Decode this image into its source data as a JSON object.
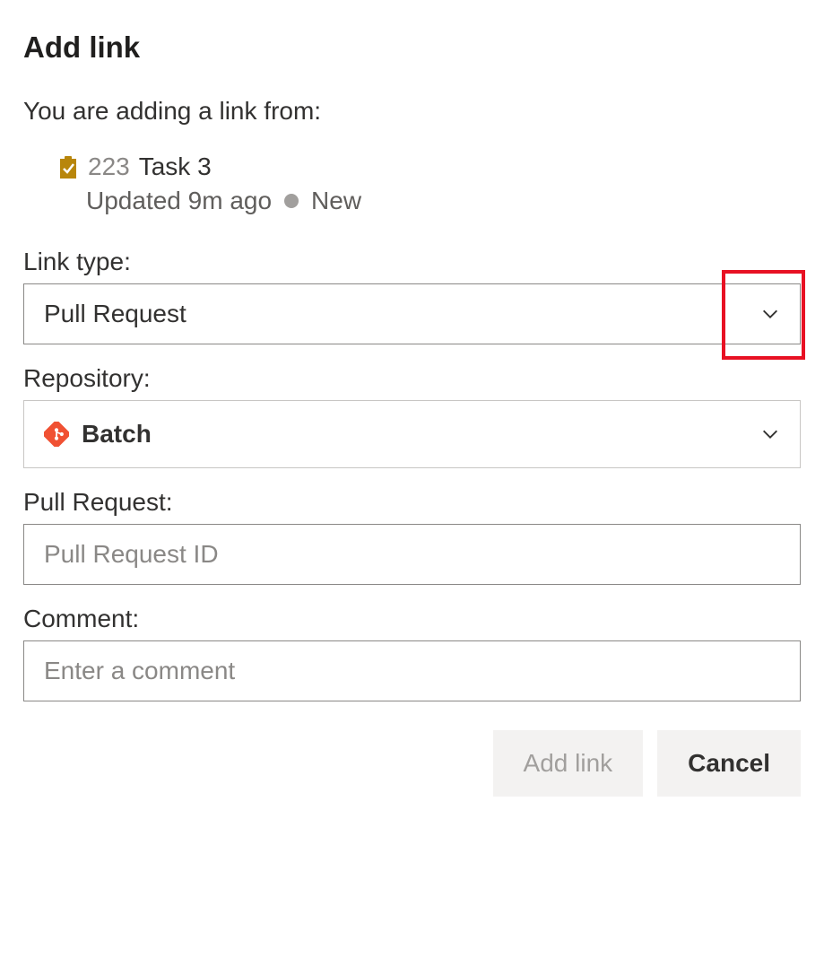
{
  "dialog": {
    "title": "Add link",
    "subtext": "You are adding a link from:"
  },
  "workitem": {
    "icon": "task-icon",
    "id": "223",
    "title": "Task 3",
    "updated": "Updated 9m ago",
    "state": "New"
  },
  "fields": {
    "link_type_label": "Link type:",
    "link_type_value": "Pull Request",
    "repository_label": "Repository:",
    "repository_value": "Batch",
    "pull_request_label": "Pull Request:",
    "pull_request_placeholder": "Pull Request ID",
    "comment_label": "Comment:",
    "comment_placeholder": "Enter a comment"
  },
  "buttons": {
    "add_link": "Add link",
    "cancel": "Cancel"
  }
}
